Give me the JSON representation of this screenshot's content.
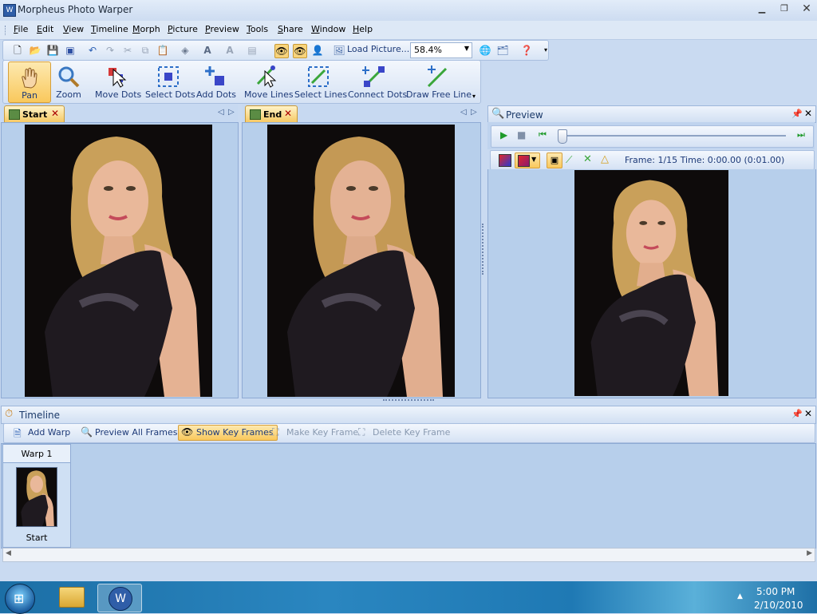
{
  "window": {
    "title": "Morpheus Photo Warper",
    "icon_glyph": "W"
  },
  "menu": [
    {
      "label": "File",
      "u": "F",
      "rest": "ile"
    },
    {
      "label": "Edit",
      "u": "E",
      "rest": "dit"
    },
    {
      "label": "View",
      "u": "V",
      "rest": "iew"
    },
    {
      "label": "Timeline",
      "u": "T",
      "rest": "imeline"
    },
    {
      "label": "Morph",
      "u": "M",
      "rest": "orph"
    },
    {
      "label": "Picture",
      "u": "P",
      "rest": "icture"
    },
    {
      "label": "Preview",
      "u": "P",
      "rest": "review"
    },
    {
      "label": "Tools",
      "u": "T",
      "rest": "ools"
    },
    {
      "label": "Share",
      "u": "S",
      "rest": "hare"
    },
    {
      "label": "Window",
      "u": "W",
      "rest": "indow"
    },
    {
      "label": "Help",
      "u": "H",
      "rest": "elp"
    }
  ],
  "toolbar": {
    "load_picture": "Load Picture...",
    "zoom": "58.4%"
  },
  "tools": [
    {
      "label": "Pan",
      "icon": "hand-icon"
    },
    {
      "label": "Zoom",
      "icon": "magnifier-icon"
    },
    {
      "label": "Move Dots",
      "icon": "move-dots-icon"
    },
    {
      "label": "Select Dots",
      "icon": "select-dots-icon"
    },
    {
      "label": "Add Dots",
      "icon": "add-dots-icon"
    },
    {
      "label": "Move Lines",
      "icon": "move-lines-icon"
    },
    {
      "label": "Select Lines",
      "icon": "select-lines-icon"
    },
    {
      "label": "Connect Dots",
      "icon": "connect-dots-icon"
    },
    {
      "label": "Draw Free Line",
      "icon": "draw-free-line-icon"
    }
  ],
  "panels": {
    "start": "Start",
    "end": "End",
    "preview": "Preview"
  },
  "preview": {
    "frame_info": "Frame: 1/15 Time: 0:00.00 (0:01.00)",
    "slider_position": 0.0
  },
  "timeline": {
    "title": "Timeline",
    "buttons": {
      "add_warp": "Add Warp",
      "preview_all": "Preview All Frames",
      "show_key_frames": "Show Key Frames",
      "make_key_frame": "Make Key Frame",
      "delete_key_frame": "Delete Key Frame"
    },
    "warp_name": "Warp 1",
    "frame_label": "Start"
  },
  "taskbar": {
    "time": "5:00 PM",
    "date": "2/10/2010"
  },
  "colors": {
    "accent": "#f9c85c",
    "panel_bg": "#b7cfeb",
    "taskbar": "#2a86c0"
  }
}
